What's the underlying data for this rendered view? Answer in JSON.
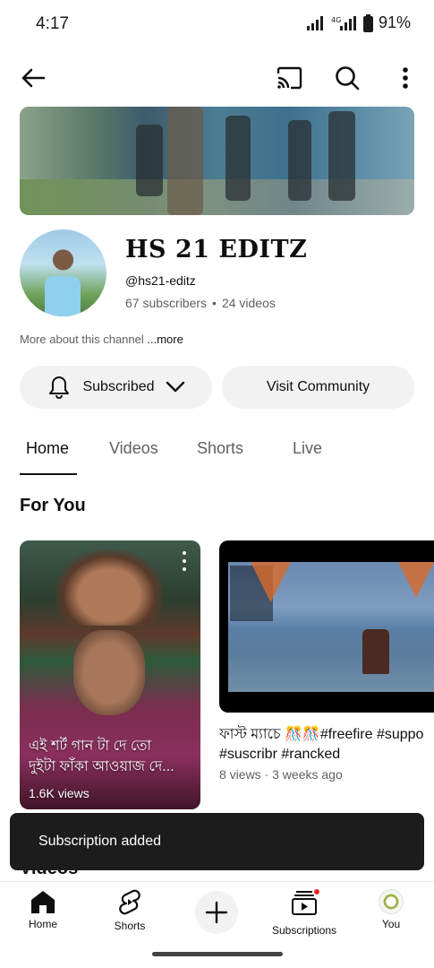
{
  "status_bar": {
    "time": "4:17",
    "battery": "91%"
  },
  "top_bar": {
    "icons": [
      "back-arrow-icon",
      "cast-icon",
      "search-icon",
      "more-vert-icon"
    ]
  },
  "channel": {
    "name": "HS 21 EDITZ",
    "handle": "@hs21-editz",
    "subscribers": "67 subscribers",
    "separator": "•",
    "videos_count": "24 videos",
    "about": "More about this channel",
    "about_more": "...more"
  },
  "actions": {
    "subscribed_label": "Subscribed",
    "community_label": "Visit Community"
  },
  "tabs": [
    {
      "label": "Home",
      "active": true
    },
    {
      "label": "Videos",
      "active": false
    },
    {
      "label": "Shorts",
      "active": false
    },
    {
      "label": "Live",
      "active": false
    }
  ],
  "for_you": {
    "title": "For You",
    "short": {
      "title_line1": "এই শর্ট গান টা দে তো",
      "title_line2": "দুইটা ফাঁকা আওয়াজ দে...",
      "views": "1.6K views"
    },
    "video": {
      "title_line1": "ফাস্ট ম্যাচে 🎊🎊#freefire #suppo",
      "title_line2": "#suscribr #rancked",
      "meta": "8 views · 3 weeks ago"
    }
  },
  "videos_section": {
    "title": "Videos"
  },
  "toast": {
    "message": "Subscription added"
  },
  "bottom_nav": {
    "items": [
      {
        "label": "Home"
      },
      {
        "label": "Shorts"
      },
      {
        "label": "Subscriptions"
      },
      {
        "label": "You"
      }
    ]
  },
  "colors": {
    "text_primary": "#0f0f0f",
    "text_secondary": "#606060",
    "pill_bg": "#f2f2f2",
    "toast_bg": "#1c1c1c",
    "notification_dot": "#e3262b"
  }
}
